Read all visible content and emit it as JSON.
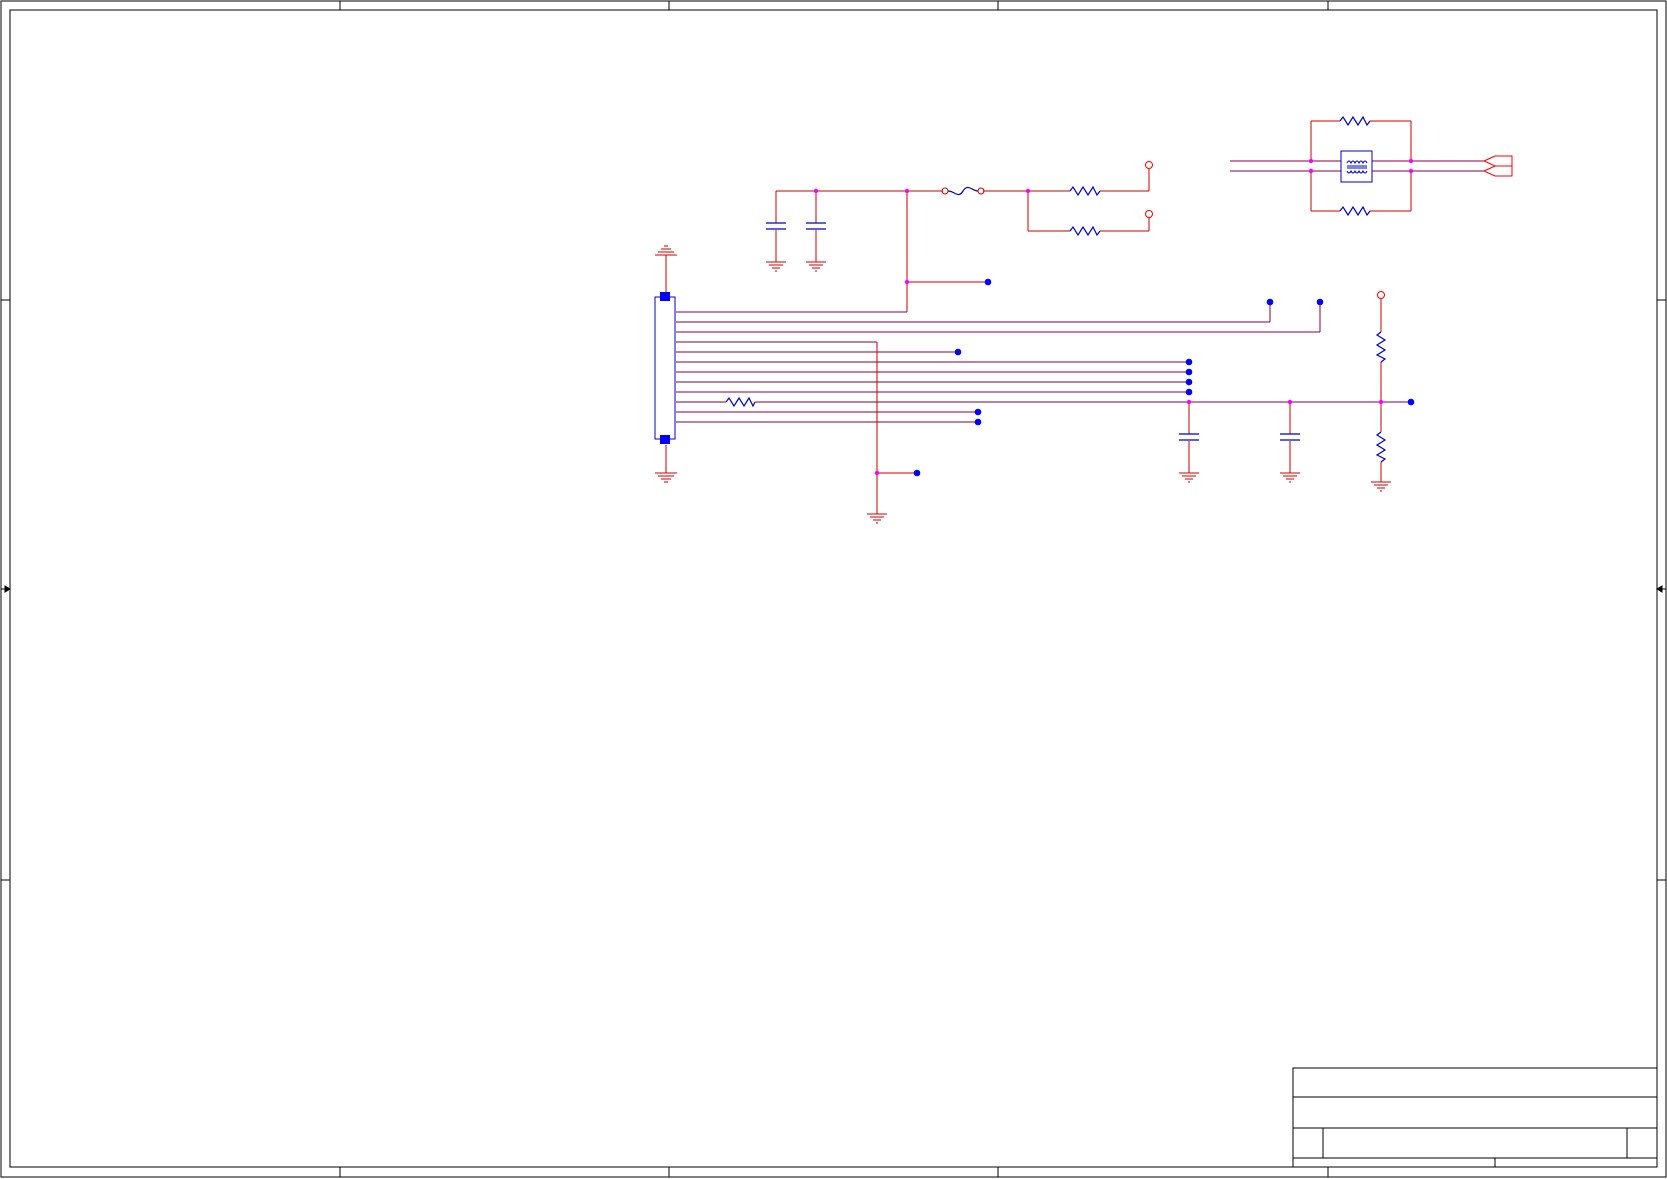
{
  "sheet": {
    "name": "schematic-sheet",
    "title_block_rows": 4
  },
  "colors": {
    "frame": "#000000",
    "wire": "#cc0000",
    "bus_wire": "#800040",
    "component": "#0000cc",
    "junction": "#ff00ff",
    "port": "#0000ff",
    "power_port": "#ff0000"
  },
  "icons": {
    "ground": "ground-icon",
    "capacitor": "capacitor-icon",
    "resistor": "resistor-icon",
    "fuse": "fuse-icon",
    "connector": "connector-icon",
    "common_mode_choke": "choke-icon",
    "net_port": "net-port-icon",
    "power_port": "power-port-icon"
  }
}
